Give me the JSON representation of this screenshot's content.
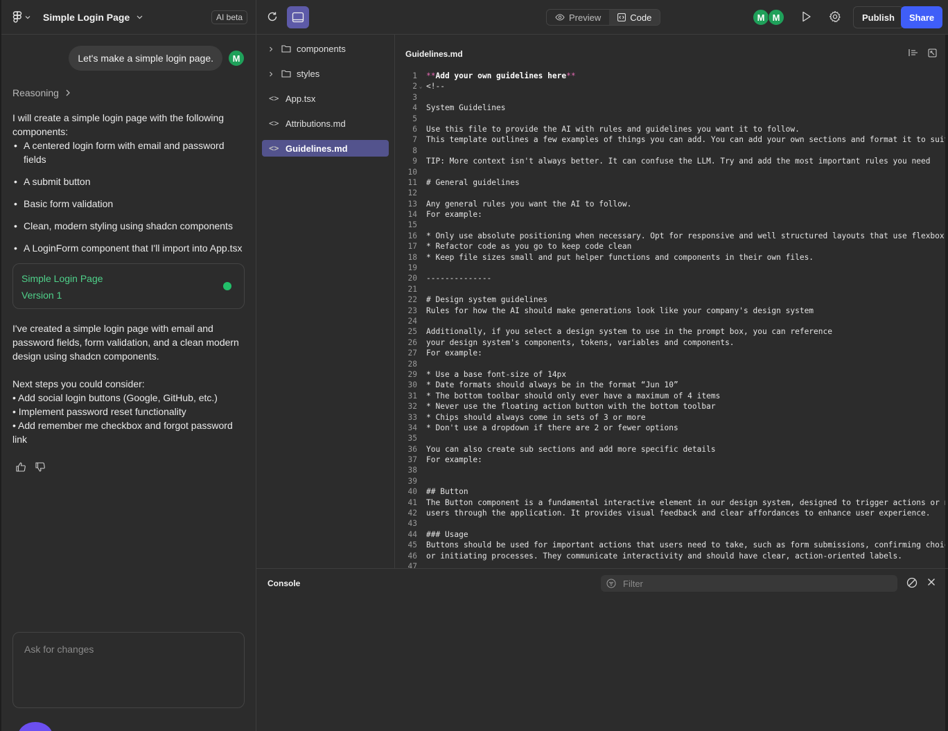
{
  "project": {
    "title": "Simple Login Page",
    "ai_badge": "AI beta"
  },
  "chat": {
    "user_message": "Let's make a simple login page.",
    "user_initial": "M",
    "reasoning_label": "Reasoning",
    "intro": "I will create a simple login page with the following components:",
    "bullets": [
      "A centered login form with email and password fields",
      "A submit button",
      "Basic form validation",
      "Clean, modern styling using shadcn components",
      "A LoginForm component that I'll import into App.tsx"
    ],
    "version_card": {
      "title": "Simple Login Page",
      "version": "Version 1"
    },
    "summary": "I've created a simple login page with email and password fields, form validation, and a clean modern design using shadcn components.",
    "next_steps_heading": "Next steps you could consider:",
    "next_steps": [
      "• Add social login buttons (Google, GitHub, etc.)",
      "• Implement password reset functionality",
      "• Add remember me checkbox and forgot password link"
    ],
    "input_placeholder": "Ask for changes"
  },
  "toolbar": {
    "preview_label": "Preview",
    "code_label": "Code",
    "collaborators": [
      "M",
      "M"
    ],
    "publish_label": "Publish",
    "share_label": "Share"
  },
  "file_tree": [
    {
      "label": "components",
      "kind": "folder"
    },
    {
      "label": "styles",
      "kind": "folder"
    },
    {
      "label": "App.tsx",
      "kind": "file"
    },
    {
      "label": "Attributions.md",
      "kind": "file"
    },
    {
      "label": "Guidelines.md",
      "kind": "file",
      "active": true
    }
  ],
  "editor": {
    "filename": "Guidelines.md",
    "lines": [
      "**Add your own guidelines here**",
      "<!--",
      "",
      "System Guidelines",
      "",
      "Use this file to provide the AI with rules and guidelines you want it to follow.",
      "This template outlines a few examples of things you can add. You can add your own sections and format it to suit yo",
      "",
      "TIP: More context isn't always better. It can confuse the LLM. Try and add the most important rules you need",
      "",
      "# General guidelines",
      "",
      "Any general rules you want the AI to follow.",
      "For example:",
      "",
      "* Only use absolute positioning when necessary. Opt for responsive and well structured layouts that use flexbox and",
      "* Refactor code as you go to keep code clean",
      "* Keep file sizes small and put helper functions and components in their own files.",
      "",
      "--------------",
      "",
      "# Design system guidelines",
      "Rules for how the AI should make generations look like your company's design system",
      "",
      "Additionally, if you select a design system to use in the prompt box, you can reference",
      "your design system's components, tokens, variables and components.",
      "For example:",
      "",
      "* Use a base font-size of 14px",
      "* Date formats should always be in the format “Jun 10”",
      "* The bottom toolbar should only ever have a maximum of 4 items",
      "* Never use the floating action button with the bottom toolbar",
      "* Chips should always come in sets of 3 or more",
      "* Don't use a dropdown if there are 2 or fewer options",
      "",
      "You can also create sub sections and add more specific details",
      "For example:",
      "",
      "",
      "## Button",
      "The Button component is a fundamental interactive element in our design system, designed to trigger actions or navi",
      "users through the application. It provides visual feedback and clear affordances to enhance user experience.",
      "",
      "### Usage",
      "Buttons should be used for important actions that users need to take, such as form submissions, confirming choices,",
      "or initiating processes. They communicate interactivity and should have clear, action-oriented labels.",
      ""
    ]
  },
  "console": {
    "title": "Console",
    "filter_placeholder": "Filter"
  },
  "colors": {
    "accent": "#3f5ef8",
    "avatar": "#1fa05a",
    "version": "#4fd18a",
    "selected": "#53538d"
  }
}
